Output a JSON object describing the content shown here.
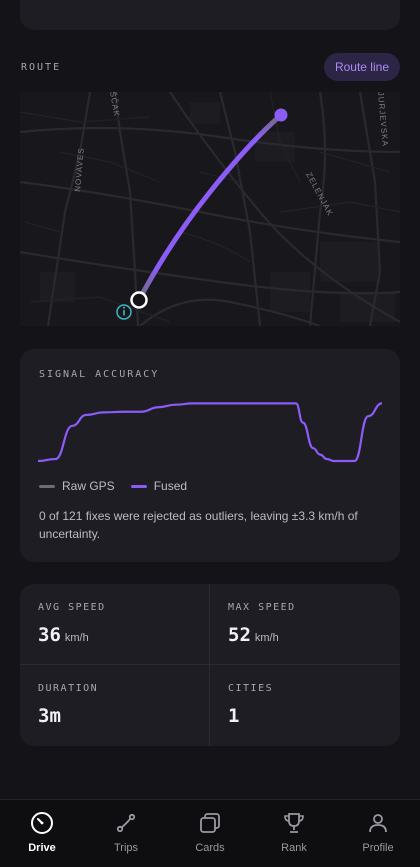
{
  "route": {
    "label": "ROUTE",
    "button_label": "Route line",
    "streets": [
      "NOVAVES",
      "ŠČAK",
      "ZELENJAK",
      "JURJEVSKA"
    ]
  },
  "signal": {
    "label": "SIGNAL ACCURACY",
    "legend": [
      {
        "name": "Raw GPS",
        "color": "#6d6b73"
      },
      {
        "name": "Fused",
        "color": "#8b5cf6"
      }
    ],
    "note": "0 of 121 fixes were rejected as outliers, leaving ±3.3 km/h of uncertainty."
  },
  "chart_data": {
    "type": "line",
    "title": "",
    "xlabel": "",
    "ylabel": "",
    "series": [
      {
        "name": "Fused",
        "color": "#8b5cf6",
        "x": [
          0,
          5,
          10,
          14,
          19,
          25,
          30,
          35,
          40,
          45,
          50,
          55,
          60,
          65,
          70,
          73,
          75,
          77,
          80,
          82,
          84,
          86,
          88,
          90,
          92,
          96,
          100
        ],
        "values": [
          0,
          0.03,
          0.55,
          0.72,
          0.76,
          0.77,
          0.77,
          0.84,
          0.88,
          0.9,
          0.9,
          0.9,
          0.9,
          0.9,
          0.9,
          0.9,
          0.9,
          0.6,
          0.2,
          0.1,
          0.03,
          0.0,
          0.0,
          0.0,
          0.0,
          0.7,
          0.9
        ]
      }
    ],
    "ylim": [
      0,
      1
    ]
  },
  "stats": [
    {
      "label": "AVG SPEED",
      "value": "36",
      "unit": "km/h"
    },
    {
      "label": "MAX SPEED",
      "value": "52",
      "unit": "km/h"
    },
    {
      "label": "DURATION",
      "value": "3m",
      "unit": ""
    },
    {
      "label": "CITIES",
      "value": "1",
      "unit": ""
    }
  ],
  "nav": [
    {
      "label": "Drive",
      "icon": "gauge-icon",
      "active": true
    },
    {
      "label": "Trips",
      "icon": "route-icon",
      "active": false
    },
    {
      "label": "Cards",
      "icon": "cards-icon",
      "active": false
    },
    {
      "label": "Rank",
      "icon": "trophy-icon",
      "active": false
    },
    {
      "label": "Profile",
      "icon": "user-icon",
      "active": false
    }
  ]
}
